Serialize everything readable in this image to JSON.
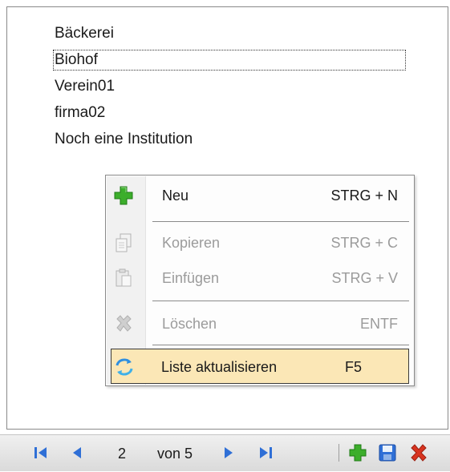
{
  "list": {
    "items": [
      "Bäckerei",
      "Biohof",
      "Verein01",
      "firma02",
      "Noch eine Institution"
    ],
    "focused_index": 1
  },
  "context_menu": {
    "new": {
      "label": "Neu",
      "shortcut": "STRG + N",
      "icon": "plus-icon"
    },
    "copy": {
      "label": "Kopieren",
      "shortcut": "STRG + C",
      "icon": "copy-icon"
    },
    "paste": {
      "label": "Einfügen",
      "shortcut": "STRG + V",
      "icon": "paste-icon"
    },
    "delete": {
      "label": "Löschen",
      "shortcut": "ENTF",
      "icon": "delete-icon"
    },
    "refresh": {
      "label": "Liste aktualisieren",
      "shortcut": "F5",
      "icon": "refresh-icon"
    }
  },
  "navigator": {
    "position": "2",
    "of_label": "von 5"
  },
  "colors": {
    "nav_blue": "#2f6fd6",
    "add_green": "#3cae2b",
    "delete_red": "#d8331f",
    "highlight": "#fbe7b6"
  }
}
